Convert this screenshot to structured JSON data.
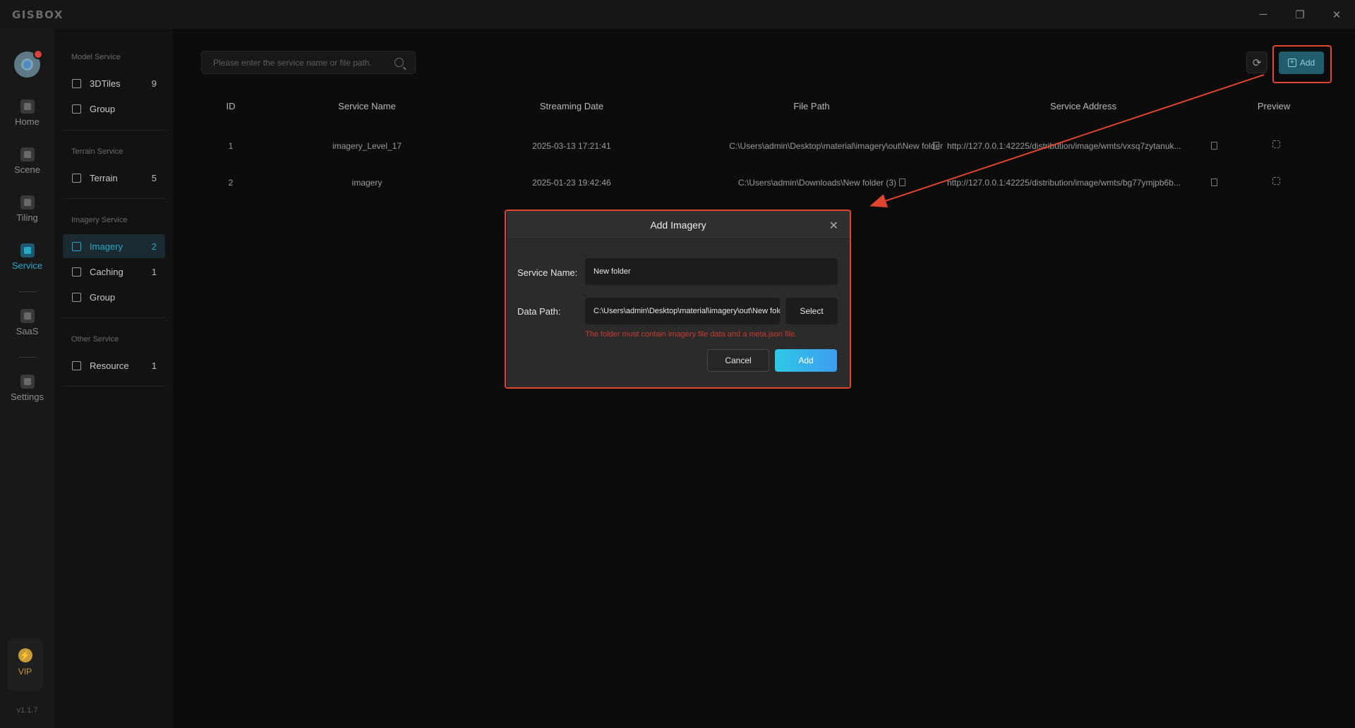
{
  "app": {
    "logo": "GISBOX"
  },
  "window": {
    "minimize": "─",
    "restore": "❐",
    "close": "✕"
  },
  "rail": {
    "items": [
      {
        "label": "Home",
        "icon": "home-icon"
      },
      {
        "label": "Scene",
        "icon": "scene-icon"
      },
      {
        "label": "Tiling",
        "icon": "tiling-icon"
      },
      {
        "label": "Service",
        "icon": "service-icon"
      },
      {
        "label": "SaaS",
        "icon": "saas-icon"
      },
      {
        "label": "Settings",
        "icon": "settings-icon"
      }
    ],
    "vip_label": "VIP",
    "vip_icon": "⚡",
    "version": "v1.1.7"
  },
  "sidebar": {
    "sections": [
      {
        "title": "Model Service"
      },
      {
        "title": "Terrain Service"
      },
      {
        "title": "Imagery Service"
      },
      {
        "title": "Other Service"
      }
    ],
    "items": [
      {
        "label": "3DTiles",
        "count": "9"
      },
      {
        "label": "Group",
        "count": ""
      },
      {
        "label": "Terrain",
        "count": "5"
      },
      {
        "label": "Imagery",
        "count": "2"
      },
      {
        "label": "Caching",
        "count": "1"
      },
      {
        "label": "Group",
        "count": ""
      },
      {
        "label": "Resource",
        "count": "1"
      }
    ]
  },
  "toolbar": {
    "search_placeholder": "Please enter the service name or file path.",
    "refresh_icon": "⟳",
    "add_label": "Add",
    "add_icon": "+"
  },
  "table": {
    "headers": [
      "ID",
      "Service Name",
      "Streaming Date",
      "File Path",
      "Service Address",
      "Preview"
    ],
    "rows": [
      {
        "id": "1",
        "name": "imagery_Level_17",
        "date": "2025-03-13 17:21:41",
        "path": "C:\\Users\\admin\\Desktop\\material\\imagery\\out\\New folder",
        "address": "http://127.0.0.1:42225/distribution/image/wmts/vxsq7zytanuk..."
      },
      {
        "id": "2",
        "name": "imagery",
        "date": "2025-01-23 19:42:46",
        "path": "C:\\Users\\admin\\Downloads\\New folder (3)",
        "address": "http://127.0.0.1:42225/distribution/image/wmts/bg77ymjpb6b..."
      }
    ]
  },
  "dialog": {
    "title": "Add Imagery",
    "close_icon": "✕",
    "service_name_label": "Service Name:",
    "service_name_value": "New folder",
    "data_path_label": "Data Path:",
    "data_path_value": "C:\\Users\\admin\\Desktop\\material\\imagery\\out\\New folder",
    "select_label": "Select",
    "hint": "The folder must contain imagery file data and a meta.json file.",
    "cancel_label": "Cancel",
    "add_label": "Add"
  },
  "colors": {
    "accent": "#2aa8c7",
    "highlight": "#e0452f",
    "error": "#c83a32"
  }
}
